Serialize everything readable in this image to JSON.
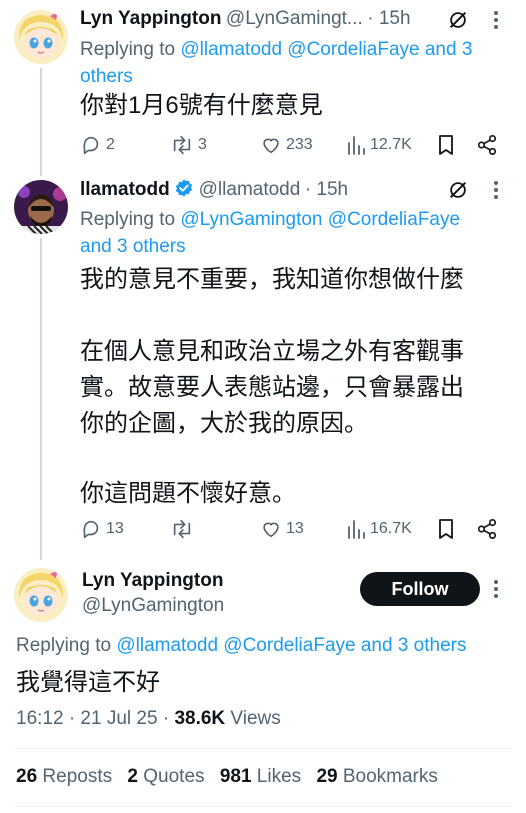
{
  "tweets": [
    {
      "name": "Lyn Yappington",
      "handle": "@LynGamingt...",
      "time": "· 15h",
      "reply_prefix": "Replying to",
      "reply_mentions_a": "@llamatodd @CordeliaFaye and 3",
      "reply_mentions_b": "others",
      "body": [
        "你對1月6號有什麼意見"
      ],
      "replies": "2",
      "reposts": "3",
      "likes": "233",
      "views": "12.7K"
    },
    {
      "name": "llamatodd",
      "handle": "@llamatodd",
      "time": "· 15h",
      "reply_prefix": "Replying to",
      "reply_mentions_a": "@LynGamington @CordeliaFaye",
      "reply_mentions_b": "and 3 others",
      "body": [
        "我的意見不重要，我知道你想做什麼",
        "在個人意見和政治立場之外有客觀事",
        "實。故意要人表態站邊，只會暴露出",
        "你的企圖，大於我的原因。",
        "你這問題不懷好意。"
      ],
      "replies": "13",
      "reposts": "",
      "likes": "13",
      "views": "16.7K"
    }
  ],
  "main": {
    "name": "Lyn Yappington",
    "handle": "@LynGamington",
    "follow_label": "Follow",
    "reply_prefix": "Replying to",
    "reply_mentions": "@llamatodd @CordeliaFaye and 3 others",
    "body": "我覺得這不好",
    "timestamp": "16:12 · 21 Jul 25 ·",
    "views_count": "38.6K",
    "views_label": "Views",
    "stats": [
      {
        "num": "26",
        "label": "Reposts"
      },
      {
        "num": "2",
        "label": "Quotes"
      },
      {
        "num": "981",
        "label": "Likes"
      },
      {
        "num": "29",
        "label": "Bookmarks"
      }
    ]
  },
  "colors": {
    "link": "#1d9bf0",
    "muted": "#536471",
    "text": "#0f1419",
    "verified": "#1d9bf0"
  },
  "icons": [
    "reply-icon",
    "repost-icon",
    "like-icon",
    "views-icon",
    "bookmark-icon",
    "share-icon",
    "grok-icon",
    "more-icon",
    "verified-badge-icon"
  ]
}
